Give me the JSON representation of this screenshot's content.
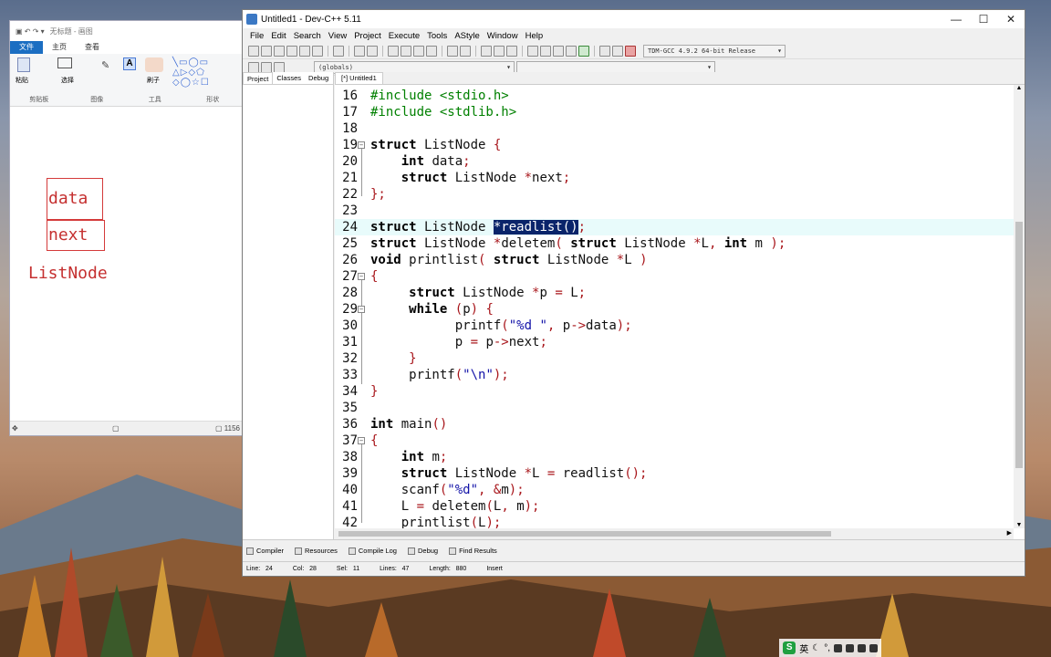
{
  "paint": {
    "title": "无标题 - 画图",
    "tabs": [
      "文件",
      "主页",
      "查看"
    ],
    "tools_group_labels": [
      "剪贴板",
      "图像",
      "工具",
      "形状"
    ],
    "paste_label": "粘贴",
    "select_label": "选择",
    "brush_label": "刷子",
    "drawing": {
      "field1": "data",
      "field2": "next",
      "caption": "ListNode"
    },
    "status_size": "1156"
  },
  "devcpp": {
    "title": "Untitled1 - Dev-C++ 5.11",
    "window_controls": [
      "—",
      "☐",
      "✕"
    ],
    "menu": [
      "File",
      "Edit",
      "Search",
      "View",
      "Project",
      "Execute",
      "Tools",
      "AStyle",
      "Window",
      "Help"
    ],
    "compiler_select": "TDM-GCC 4.9.2 64-bit Release",
    "scope_select": "(globals)",
    "left_tabs": [
      "Project",
      "Classes",
      "Debug"
    ],
    "editor_tab": "[*] Untitled1",
    "bottom_tabs": [
      "Compiler",
      "Resources",
      "Compile Log",
      "Debug",
      "Find Results"
    ],
    "status": {
      "line": "Line:",
      "line_val": "24",
      "col": "Col:",
      "col_val": "28",
      "sel": "Sel:",
      "sel_val": "11",
      "lines": "Lines:",
      "lines_val": "47",
      "length": "Length:",
      "length_val": "880",
      "mode": "Insert"
    }
  },
  "code_lines": [
    {
      "n": "16",
      "html": "<span class='inc'>#include &lt;stdio.h&gt;</span>"
    },
    {
      "n": "17",
      "html": "<span class='inc'>#include &lt;stdlib.h&gt;</span>"
    },
    {
      "n": "18",
      "html": ""
    },
    {
      "n": "19",
      "html": "<span class='k'>struct</span> ListNode <span class='p'>{</span>",
      "fold": true
    },
    {
      "n": "20",
      "html": "    <span class='k'>int</span> data<span class='p'>;</span>"
    },
    {
      "n": "21",
      "html": "    <span class='k'>struct</span> ListNode <span class='p'>*</span>next<span class='p'>;</span>"
    },
    {
      "n": "22",
      "html": "<span class='p'>};</span>"
    },
    {
      "n": "23",
      "html": ""
    },
    {
      "n": "24",
      "html": "<span class='k'>struct</span> ListNode <span class='sel'>*readlist()</span><span class='p'>;</span>",
      "cur": true
    },
    {
      "n": "25",
      "html": "<span class='k'>struct</span> ListNode <span class='p'>*</span>deletem<span class='p'>(</span> <span class='k'>struct</span> ListNode <span class='p'>*</span>L<span class='p'>,</span> <span class='k'>int</span> m <span class='p'>);</span>"
    },
    {
      "n": "26",
      "html": "<span class='k'>void</span> printlist<span class='p'>(</span> <span class='k'>struct</span> ListNode <span class='p'>*</span>L <span class='p'>)</span>"
    },
    {
      "n": "27",
      "html": "<span class='p'>{</span>",
      "fold": true
    },
    {
      "n": "28",
      "html": "     <span class='k'>struct</span> ListNode <span class='p'>*</span>p <span class='p'>=</span> L<span class='p'>;</span>"
    },
    {
      "n": "29",
      "html": "     <span class='k'>while</span> <span class='p'>(</span>p<span class='p'>)</span> <span class='p'>{</span>",
      "fold": true
    },
    {
      "n": "30",
      "html": "           printf<span class='p'>(</span><span class='s'>\"%d \"</span><span class='p'>,</span> p<span class='p'>-&gt;</span>data<span class='p'>);</span>"
    },
    {
      "n": "31",
      "html": "           p <span class='p'>=</span> p<span class='p'>-&gt;</span>next<span class='p'>;</span>"
    },
    {
      "n": "32",
      "html": "     <span class='p'>}</span>"
    },
    {
      "n": "33",
      "html": "     printf<span class='p'>(</span><span class='s'>\"\\n\"</span><span class='p'>);</span>"
    },
    {
      "n": "34",
      "html": "<span class='p'>}</span>"
    },
    {
      "n": "35",
      "html": ""
    },
    {
      "n": "36",
      "html": "<span class='k'>int</span> main<span class='p'>()</span>"
    },
    {
      "n": "37",
      "html": "<span class='p'>{</span>",
      "fold": true
    },
    {
      "n": "38",
      "html": "    <span class='k'>int</span> m<span class='p'>;</span>"
    },
    {
      "n": "39",
      "html": "    <span class='k'>struct</span> ListNode <span class='p'>*</span>L <span class='p'>=</span> readlist<span class='p'>();</span>"
    },
    {
      "n": "40",
      "html": "    scanf<span class='p'>(</span><span class='s'>\"%d\"</span><span class='p'>,</span> <span class='p'>&amp;</span>m<span class='p'>);</span>"
    },
    {
      "n": "41",
      "html": "    L <span class='p'>=</span> deletem<span class='p'>(</span>L<span class='p'>,</span> m<span class='p'>);</span>"
    },
    {
      "n": "42",
      "html": "    printlist<span class='p'>(</span>L<span class='p'>);</span>"
    }
  ],
  "tray": {
    "ime_badge": "S",
    "ime": "英"
  },
  "colors": {
    "selection": "#0a246a",
    "current_line": "#e8fbfb",
    "punct": "#a8161b",
    "string": "#1313a8",
    "include": "#008000",
    "handwriting": "#c53030"
  }
}
